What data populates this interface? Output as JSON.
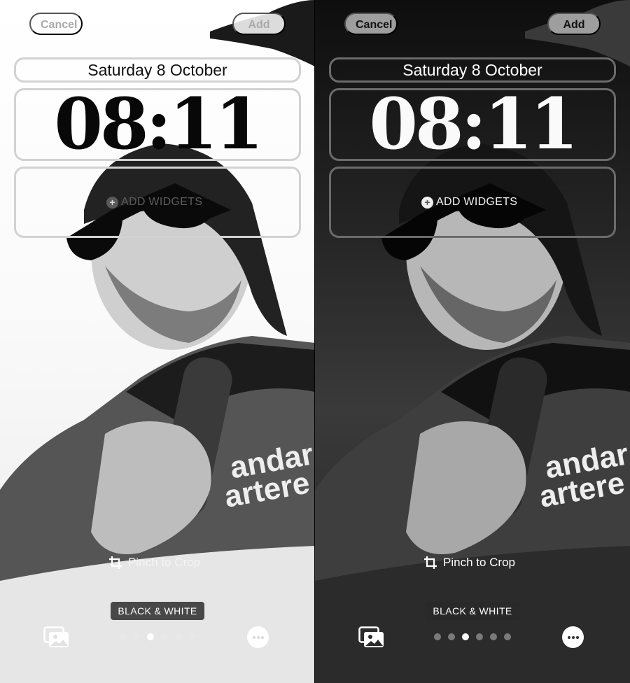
{
  "screens": [
    {
      "variant": "light",
      "top_bar": {
        "cancel_label": "Cancel",
        "add_label": "Add"
      },
      "lock_screen": {
        "date": "Saturday 8 October",
        "time": "08:11",
        "add_widgets_label": "ADD WIDGETS",
        "add_widgets_icon": "plus-circle-icon"
      },
      "hint": {
        "icon": "crop-icon",
        "label": "Pinch to Crop"
      },
      "filter": {
        "label": "BLACK & WHITE"
      },
      "bottom_bar": {
        "photos_icon": "photo-library-icon",
        "more_icon": "ellipsis-icon",
        "page_count": 6,
        "active_page": 3
      }
    },
    {
      "variant": "dark",
      "top_bar": {
        "cancel_label": "Cancel",
        "add_label": "Add"
      },
      "lock_screen": {
        "date": "Saturday 8 October",
        "time": "08:11",
        "add_widgets_label": "ADD WIDGETS",
        "add_widgets_icon": "plus-circle-icon"
      },
      "hint": {
        "icon": "crop-icon",
        "label": "Pinch to Crop"
      },
      "filter": {
        "label": "BLACK & WHITE"
      },
      "bottom_bar": {
        "photos_icon": "photo-library-icon",
        "more_icon": "ellipsis-icon",
        "page_count": 6,
        "active_page": 3
      }
    }
  ],
  "wallpaper": {
    "description": "Black and white photo of a smiling bearded man in sunglasses and a backwards cap holding a bottle",
    "jersey_text": [
      "andar",
      "artere"
    ]
  },
  "colors": {
    "light_background": "#ffffff",
    "dark_background": "#1e1e1e",
    "active_dot": "#ffffff"
  }
}
